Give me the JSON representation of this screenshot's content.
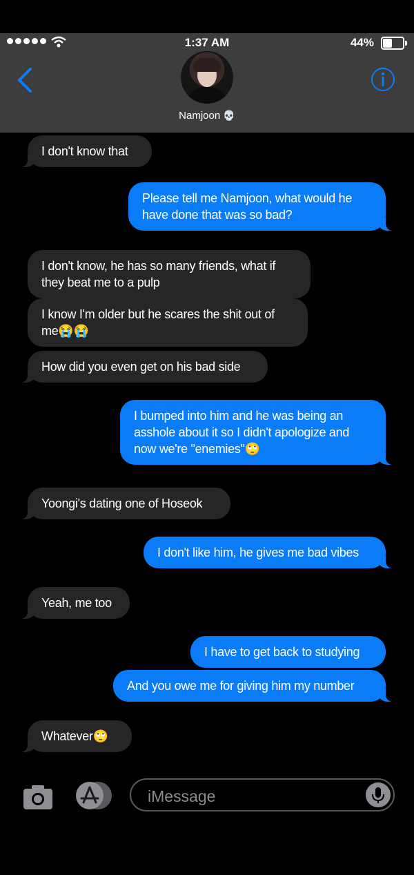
{
  "status_bar": {
    "time": "1:37 AM",
    "battery": "44%"
  },
  "header": {
    "contact_name": "Namjoon",
    "back_icon": "chevron-left-icon",
    "info_icon": "info-icon"
  },
  "messages": [
    {
      "from": "them",
      "text": "I don't know that"
    },
    {
      "from": "me",
      "lines": [
        "Please tell me Namjoon,  what would he",
        "have done that was so bad?"
      ]
    },
    {
      "from": "them",
      "lines": [
        "I don't know, he has so many friends, what if",
        "they beat me to a pulp"
      ]
    },
    {
      "from": "them",
      "lines": [
        "I know I'm older but he scares the shit out of",
        "me"
      ],
      "emoji": "😭😭"
    },
    {
      "from": "them",
      "text": "How did you even get on his bad side"
    },
    {
      "from": "me",
      "lines": [
        "I bumped into him and he was being an",
        "asshole about it so I  didn't apologize and",
        "now we're \"enemies\""
      ],
      "emoji": "🙄"
    },
    {
      "from": "them",
      "text": "Yoongi's dating one of Hoseok"
    },
    {
      "from": "me",
      "text": "I don't like him, he gives me bad vibes"
    },
    {
      "from": "them",
      "text": "Yeah, me too"
    },
    {
      "from": "me",
      "text": "I have to get back to studying"
    },
    {
      "from": "me",
      "text": "And you owe me for giving him my number"
    },
    {
      "from": "them",
      "text": "Whatever",
      "emoji": "🙄"
    }
  ],
  "input": {
    "placeholder": "iMessage"
  },
  "colors": {
    "sent_bubble": "#0b7cf8",
    "received_bubble": "#262628",
    "header": "#3d3d3d",
    "accent": "#0b7cf8"
  }
}
